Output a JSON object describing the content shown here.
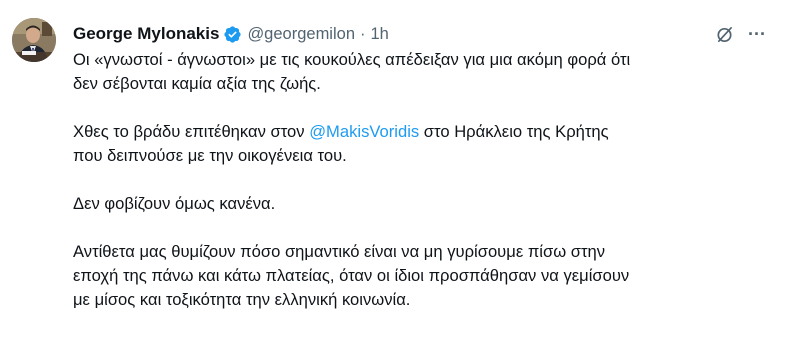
{
  "author": {
    "name": "George Mylonakis",
    "handle": "@georgemilon",
    "separator": "·",
    "time": "1h"
  },
  "icons": {
    "verified": "verified-badge-icon",
    "grok": "grok-slash-icon",
    "more": "more-icon"
  },
  "more_glyph": "···",
  "colors": {
    "accent": "#1d9bf0",
    "text": "#0f1419",
    "muted": "#536471"
  },
  "tweet": {
    "p1": "Οι «γνωστοί - άγνωστοι» με τις κουκούλες απέδειξαν για μια ακόμη φορά ότι\nδεν σέβονται καμία αξία της ζωής.",
    "p2_before": "Χθες το βράδυ επιτέθηκαν στον ",
    "p2_mention": "@MakisVoridis",
    "p2_after": " στο Ηράκλειο της Κρήτης\nπου δειπνούσε με την οικογένεια του.",
    "p3": "Δεν φοβίζουν όμως κανένα.",
    "p4": "Αντίθετα μας θυμίζουν πόσο σημαντικό είναι να μη γυρίσουμε πίσω στην\nεποχή της πάνω και κάτω πλατείας, όταν οι ίδιοι προσπάθησαν να γεμίσουν\nμε μίσος και τοξικότητα την ελληνική κοινωνία."
  }
}
